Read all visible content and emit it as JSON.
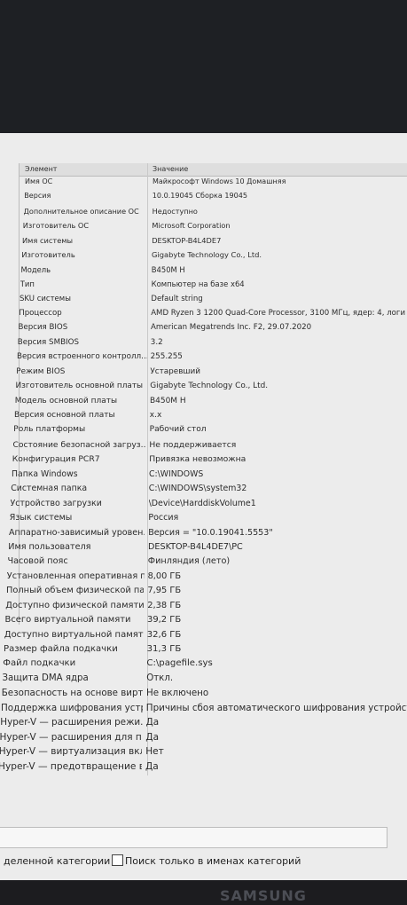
{
  "table": {
    "headers": {
      "item": "Элемент",
      "value": "Значение"
    },
    "rows": [
      {
        "k": "Имя ОС",
        "v": "Майкрософт Windows 10 Домашняя"
      },
      {
        "k": "Версия",
        "v": "10.0.19045 Сборка 19045"
      },
      {
        "k": "Дополнительное описание ОС",
        "v": "Недоступно"
      },
      {
        "k": "Изготовитель ОС",
        "v": "Microsoft Corporation"
      },
      {
        "k": "Имя системы",
        "v": "DESKTOP-B4L4DE7"
      },
      {
        "k": "Изготовитель",
        "v": "Gigabyte Technology Co., Ltd."
      },
      {
        "k": "Модель",
        "v": "B450M H"
      },
      {
        "k": "Тип",
        "v": "Компьютер на базе x64"
      },
      {
        "k": "SKU системы",
        "v": "Default string"
      },
      {
        "k": "Процессор",
        "v": "AMD Ryzen 3 1200 Quad-Core Processor, 3100 МГц, ядер: 4, логи"
      },
      {
        "k": "Версия BIOS",
        "v": "American Megatrends Inc. F2, 29.07.2020"
      },
      {
        "k": "Версия SMBIOS",
        "v": "3.2"
      },
      {
        "k": "Версия встроенного контролл...",
        "v": "255.255"
      },
      {
        "k": "Режим BIOS",
        "v": "Устаревший"
      },
      {
        "k": "Изготовитель основной платы",
        "v": "Gigabyte Technology Co., Ltd."
      },
      {
        "k": "Модель основной платы",
        "v": "B450M H"
      },
      {
        "k": "Версия основной платы",
        "v": "x.x"
      },
      {
        "k": "Роль платформы",
        "v": "Рабочий стол"
      },
      {
        "k": "Состояние безопасной загруз...",
        "v": "Не поддерживается"
      },
      {
        "k": "Конфигурация PCR7",
        "v": "Привязка невозможна"
      },
      {
        "k": "Папка Windows",
        "v": "C:\\WINDOWS"
      },
      {
        "k": "Системная папка",
        "v": "C:\\WINDOWS\\system32"
      },
      {
        "k": "Устройство загрузки",
        "v": "\\Device\\HarddiskVolume1"
      },
      {
        "k": "Язык системы",
        "v": "Россия"
      },
      {
        "k": "Аппаратно-зависимый уровен...",
        "v": "Версия = \"10.0.19041.5553\""
      },
      {
        "k": "Имя пользователя",
        "v": "DESKTOP-B4L4DE7\\PC"
      },
      {
        "k": "Часовой пояс",
        "v": "Финляндия (лето)"
      },
      {
        "k": "Установленная оперативная п...",
        "v": "8,00 ГБ"
      },
      {
        "k": "Полный объем физической па...",
        "v": "7,95 ГБ"
      },
      {
        "k": "Доступно физической памяти",
        "v": "2,38 ГБ"
      },
      {
        "k": "Всего виртуальной памяти",
        "v": "39,2 ГБ"
      },
      {
        "k": "Доступно виртуальной памяти",
        "v": "32,6 ГБ"
      },
      {
        "k": "Размер файла подкачки",
        "v": "31,3 ГБ"
      },
      {
        "k": "Файл подкачки",
        "v": "C:\\pagefile.sys"
      },
      {
        "k": "Защита DMA ядра",
        "v": "Откл."
      },
      {
        "k": "Безопасность на основе вирту...",
        "v": "Не включено"
      },
      {
        "k": "Поддержка шифрования устр...",
        "v": "Причины сбоя автоматического шифрования устройства: Д"
      },
      {
        "k": "Hyper-V — расширения режи...",
        "v": "Да"
      },
      {
        "k": "Hyper-V — расширения для п...",
        "v": "Да"
      },
      {
        "k": "Hyper-V — виртуализация вкл...",
        "v": "Нет"
      },
      {
        "k": "Hyper-V — предотвращение в...",
        "v": "Да"
      }
    ]
  },
  "footer": {
    "selected_category_label": "деленной категории",
    "search_names_label": "Поиск только в именах категорий"
  },
  "brand": {
    "logo_text": "SAMSUNG"
  }
}
